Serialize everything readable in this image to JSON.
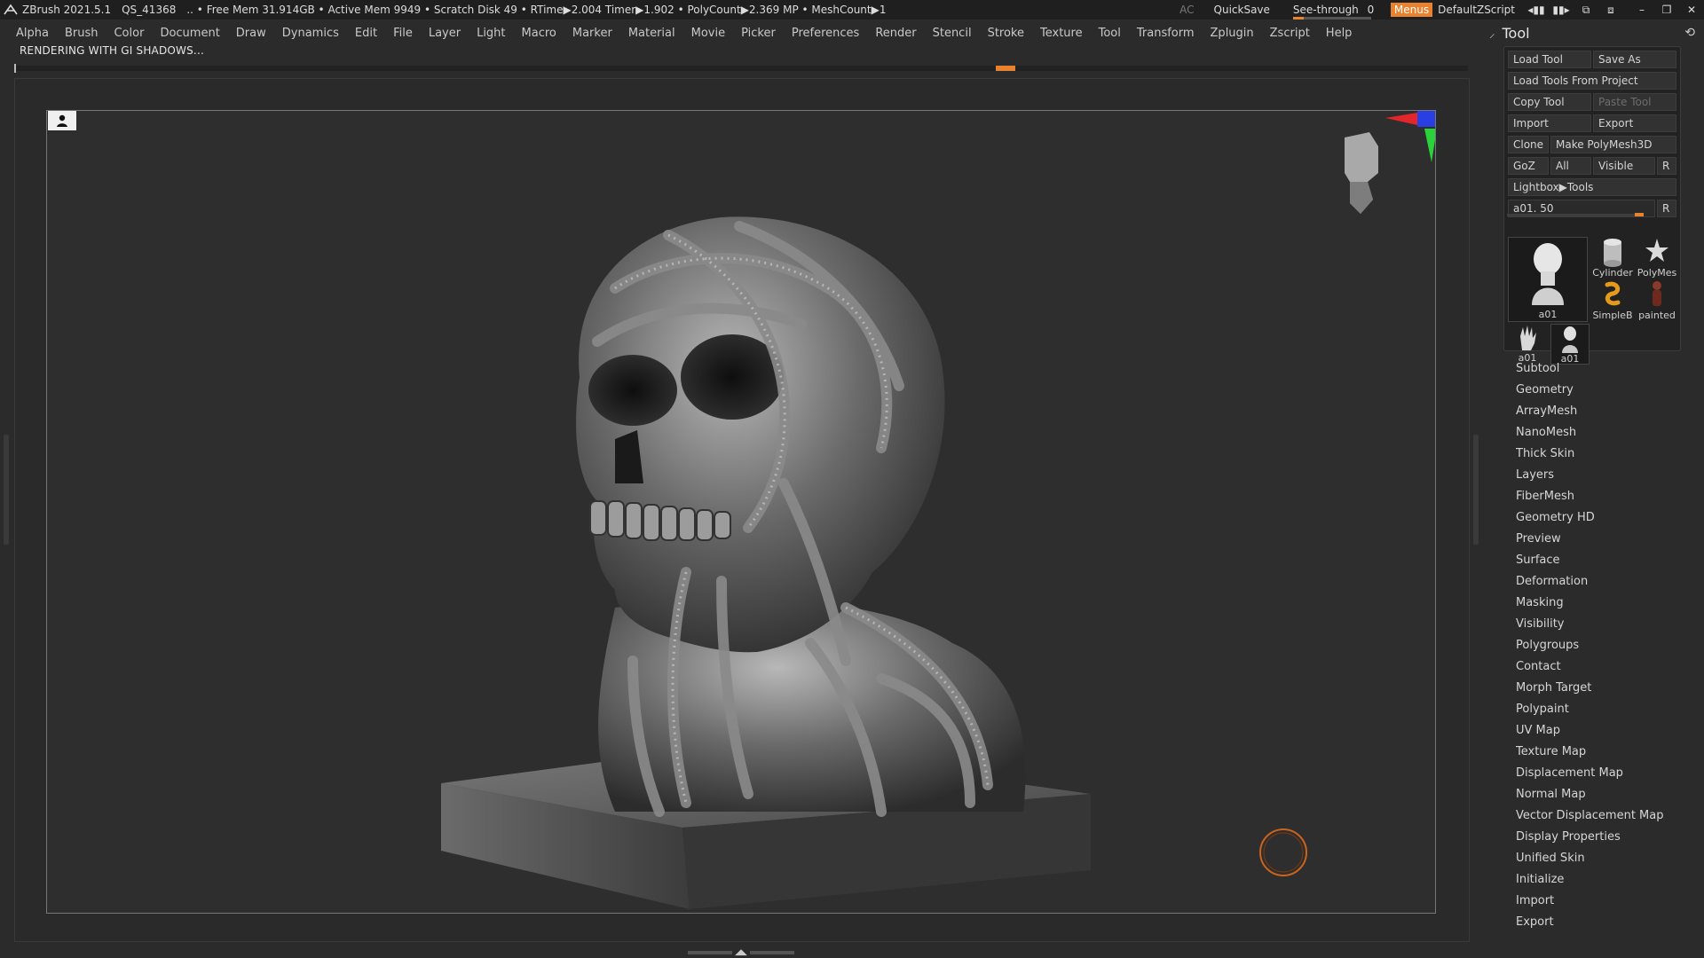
{
  "titlebar": {
    "app": "ZBrush 2021.5.1",
    "project": "QS_41368",
    "stats": ".. • Free Mem 31.914GB • Active Mem 9949 • Scratch Disk 49 •  RTime▶2.004 Timer▶1.902 • PolyCount▶2.369 MP  • MeshCount▶1",
    "ac": "AC",
    "quicksave": "QuickSave",
    "see_through_label": "See-through",
    "see_through_value": "0",
    "menus": "Menus",
    "default_script": "DefaultZScript"
  },
  "menubar": [
    "Alpha",
    "Brush",
    "Color",
    "Document",
    "Draw",
    "Dynamics",
    "Edit",
    "File",
    "Layer",
    "Light",
    "Macro",
    "Marker",
    "Material",
    "Movie",
    "Picker",
    "Preferences",
    "Render",
    "Stencil",
    "Stroke",
    "Texture",
    "Tool",
    "Transform",
    "Zplugin",
    "Zscript",
    "Help"
  ],
  "status_text": "RENDERING WITH GI SHADOWS...",
  "colors": {
    "accent": "#e8822f",
    "panel": "#2b2b2b",
    "viewport": "#2e2e2e",
    "axis_x": "#e3262b",
    "axis_y": "#2ad33a",
    "axis_z": "#2a3fe3"
  },
  "tool_panel": {
    "title": "Tool",
    "buttons": {
      "load_tool": "Load Tool",
      "save_as": "Save As",
      "load_from_project": "Load Tools From Project",
      "copy_tool": "Copy Tool",
      "paste_tool": "Paste Tool",
      "import": "Import",
      "export": "Export",
      "clone": "Clone",
      "make_polymesh": "Make PolyMesh3D",
      "goz": "GoZ",
      "all": "All",
      "visible": "Visible",
      "r": "R",
      "lightbox": "Lightbox▶Tools"
    },
    "slider_label": "a01. 50",
    "slider_r": "R",
    "thumbnails": [
      "a01",
      "Cylinder",
      "PolyMes",
      "SimpleB",
      "painted",
      "a01",
      "a01"
    ],
    "subpalettes": [
      "Subtool",
      "Geometry",
      "ArrayMesh",
      "NanoMesh",
      "Thick Skin",
      "Layers",
      "FiberMesh",
      "Geometry HD",
      "Preview",
      "Surface",
      "Deformation",
      "Masking",
      "Visibility",
      "Polygroups",
      "Contact",
      "Morph Target",
      "Polypaint",
      "UV Map",
      "Texture Map",
      "Displacement Map",
      "Normal Map",
      "Vector Displacement Map",
      "Display Properties",
      "Unified Skin",
      "Initialize",
      "Import",
      "Export"
    ]
  }
}
